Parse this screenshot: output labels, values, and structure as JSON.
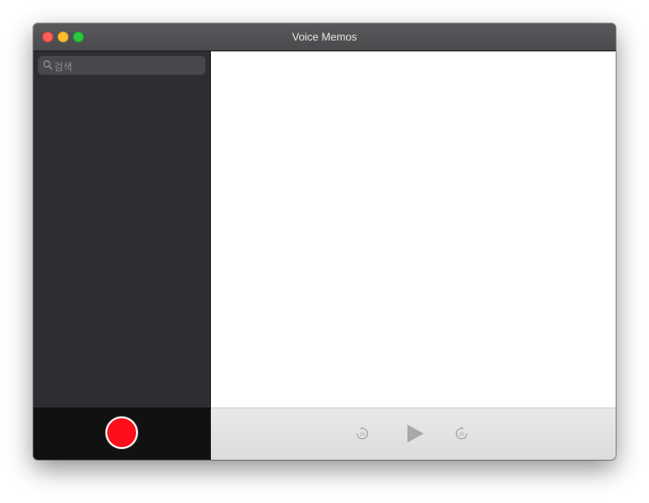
{
  "window": {
    "title": "Voice Memos"
  },
  "search": {
    "placeholder": "검색",
    "icon": "search-icon"
  },
  "playback": {
    "skip_back_icon": "skip-back-15-icon",
    "play_icon": "play-icon",
    "skip_forward_icon": "skip-forward-15-icon",
    "skip_seconds_label": "15"
  },
  "colors": {
    "record": "#fe0d1b",
    "sidebar": "#2c2e33",
    "titlebar": "#4f4f52"
  }
}
